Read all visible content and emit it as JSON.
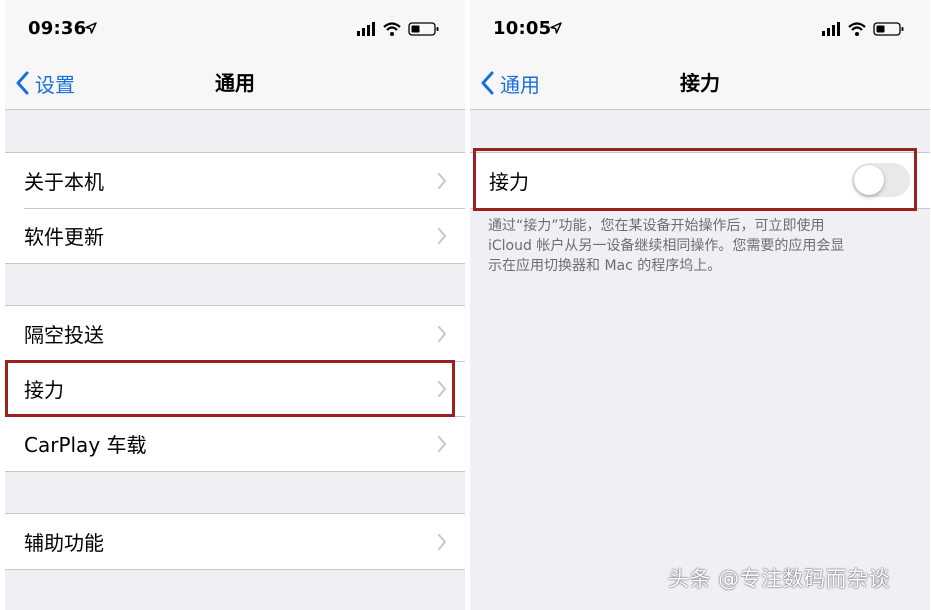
{
  "left_screen": {
    "status_bar": {
      "time": "09:36"
    },
    "nav": {
      "back_label": "设置",
      "title": "通用"
    },
    "groups": [
      {
        "items": [
          {
            "label": "关于本机"
          },
          {
            "label": "软件更新"
          }
        ]
      },
      {
        "items": [
          {
            "label": "隔空投送"
          },
          {
            "label": "接力"
          },
          {
            "label": "CarPlay 车载"
          }
        ]
      },
      {
        "items": [
          {
            "label": "辅助功能"
          }
        ]
      }
    ],
    "highlighted_item": "接力"
  },
  "right_screen": {
    "status_bar": {
      "time": "10:05"
    },
    "nav": {
      "back_label": "通用",
      "title": "接力"
    },
    "setting": {
      "label": "接力",
      "toggle_on": false
    },
    "footer_lines": [
      "通过“接力”功能，您在某设备开始操作后，可立即使用",
      "iCloud 帐户从另一设备继续相同操作。您需要的应用会显",
      "示在应用切换器和 Mac 的程序坞上。"
    ]
  },
  "watermark": "头条 @专注数码而杂谈",
  "colors": {
    "accent": "#1a6fe0",
    "highlight_border": "#9b2121",
    "background": "#efeff4",
    "separator": "#c8c7cc",
    "footer_text": "#6d6d72"
  }
}
